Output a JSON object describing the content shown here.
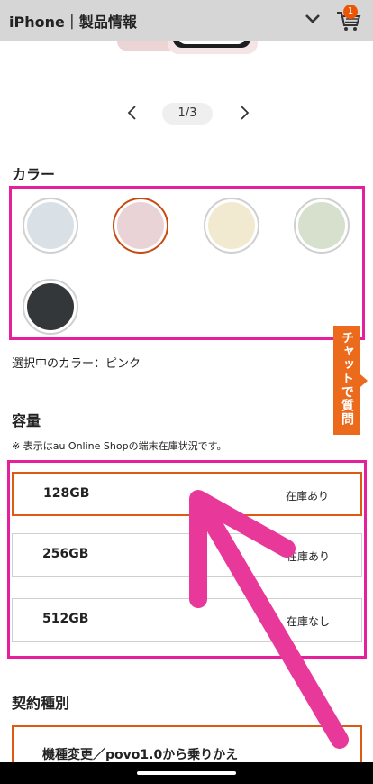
{
  "header": {
    "title": "iPhone｜製品情報",
    "cart_count": "1"
  },
  "carousel": {
    "pager": "1/3"
  },
  "color": {
    "section_title": "カラー",
    "swatches": [
      {
        "name": "blue",
        "hex": "#d9e0e6"
      },
      {
        "name": "pink",
        "hex": "#e9d3d6"
      },
      {
        "name": "yellow",
        "hex": "#f1ead0"
      },
      {
        "name": "green",
        "hex": "#d7e0cc"
      },
      {
        "name": "black",
        "hex": "#34373a"
      }
    ],
    "selected_index": 1,
    "selected_text": "選択中のカラー：ピンク"
  },
  "chat": {
    "label": "チャットで質問"
  },
  "storage": {
    "section_title": "容量",
    "note": "※ 表示はau Online Shopの端末在庫状況です。",
    "options": [
      {
        "label": "128GB",
        "stock": "在庫あり"
      },
      {
        "label": "256GB",
        "stock": "在庫あり"
      },
      {
        "label": "512GB",
        "stock": "在庫なし"
      }
    ]
  },
  "contract": {
    "section_title": "契約種別",
    "option_label": "機種変更／povo1.0から乗りかえ"
  },
  "colors": {
    "accent_orange": "#eb5505",
    "annotation_pink": "#e6209c",
    "header_gray": "#d6d6d6"
  }
}
